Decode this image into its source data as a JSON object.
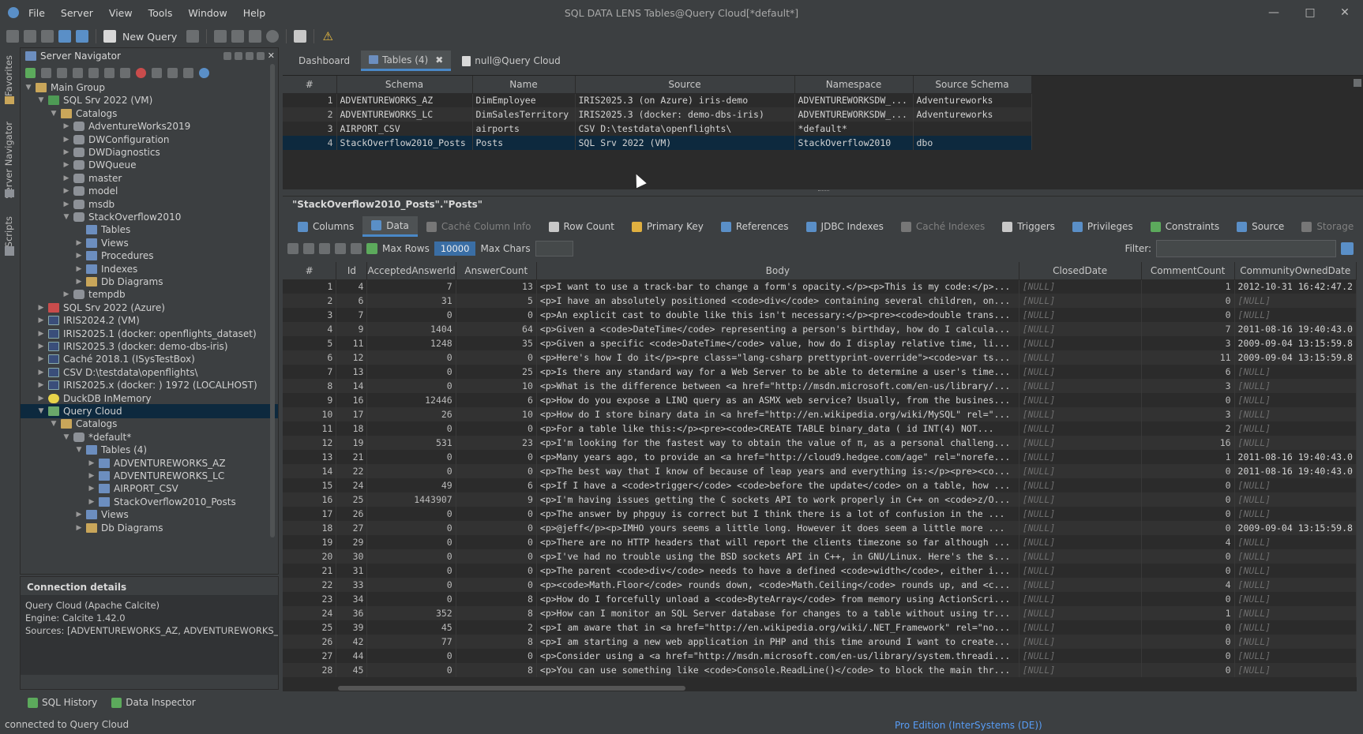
{
  "window": {
    "title": "SQL DATA LENS  Tables@Query Cloud[*default*]",
    "menu": [
      "File",
      "Server",
      "View",
      "Tools",
      "Window",
      "Help"
    ]
  },
  "toolbar": {
    "new_query_label": "New Query"
  },
  "side_tabs": [
    "Favorites",
    "Server Navigator",
    "Scripts"
  ],
  "navigator": {
    "title": "Server Navigator",
    "tree": [
      {
        "label": "Main Group",
        "depth": 0,
        "icon": "folder-icon",
        "expand": "v"
      },
      {
        "label": "SQL Srv 2022 (VM)",
        "depth": 1,
        "icon": "server-icon",
        "expand": "v"
      },
      {
        "label": "Catalogs",
        "depth": 2,
        "icon": "folder-icon",
        "expand": "v"
      },
      {
        "label": "AdventureWorks2019",
        "depth": 3,
        "icon": "database-icon",
        "expand": ">"
      },
      {
        "label": "DWConfiguration",
        "depth": 3,
        "icon": "database-icon",
        "expand": ">"
      },
      {
        "label": "DWDiagnostics",
        "depth": 3,
        "icon": "database-icon",
        "expand": ">"
      },
      {
        "label": "DWQueue",
        "depth": 3,
        "icon": "database-icon",
        "expand": ">"
      },
      {
        "label": "master",
        "depth": 3,
        "icon": "database-icon",
        "expand": ">"
      },
      {
        "label": "model",
        "depth": 3,
        "icon": "database-icon",
        "expand": ">"
      },
      {
        "label": "msdb",
        "depth": 3,
        "icon": "database-icon",
        "expand": ">"
      },
      {
        "label": "StackOverflow2010",
        "depth": 3,
        "icon": "database-icon",
        "expand": "v"
      },
      {
        "label": "Tables",
        "depth": 4,
        "icon": "table-icon",
        "expand": ""
      },
      {
        "label": "Views",
        "depth": 4,
        "icon": "table-icon",
        "expand": ">"
      },
      {
        "label": "Procedures",
        "depth": 4,
        "icon": "table-icon",
        "expand": ">"
      },
      {
        "label": "Indexes",
        "depth": 4,
        "icon": "table-icon",
        "expand": ">"
      },
      {
        "label": "Db Diagrams",
        "depth": 4,
        "icon": "folder-icon",
        "expand": ">"
      },
      {
        "label": "tempdb",
        "depth": 3,
        "icon": "database-icon",
        "expand": ">"
      },
      {
        "label": "SQL Srv 2022 (Azure)",
        "depth": 1,
        "icon": "server-red-icon",
        "expand": ">"
      },
      {
        "label": "IRIS2024.2 (VM)",
        "depth": 1,
        "icon": "iris-icon",
        "expand": ">"
      },
      {
        "label": "IRIS2025.1 (docker: openflights_dataset)",
        "depth": 1,
        "icon": "iris-icon",
        "expand": ">"
      },
      {
        "label": "IRIS2025.3 (docker: demo-dbs-iris)",
        "depth": 1,
        "icon": "iris-icon",
        "expand": ">"
      },
      {
        "label": "Caché 2018.1 (ISysTestBox)",
        "depth": 1,
        "icon": "iris-icon",
        "expand": ">"
      },
      {
        "label": "CSV D:\\testdata\\openflights\\",
        "depth": 1,
        "icon": "iris-icon",
        "expand": ">"
      },
      {
        "label": "IRIS2025.x (docker: ) 1972 (LOCALHOST)",
        "depth": 1,
        "icon": "iris-icon",
        "expand": ">"
      },
      {
        "label": "DuckDB InMemory",
        "depth": 1,
        "icon": "duckdb-icon",
        "expand": ">"
      },
      {
        "label": "Query Cloud",
        "depth": 1,
        "icon": "query-cloud-icon",
        "expand": "v",
        "selected": true
      },
      {
        "label": "Catalogs",
        "depth": 2,
        "icon": "folder-icon",
        "expand": "v"
      },
      {
        "label": "*default*",
        "depth": 3,
        "icon": "database-icon",
        "expand": "v"
      },
      {
        "label": "Tables (4)",
        "depth": 4,
        "icon": "table-icon",
        "expand": "v"
      },
      {
        "label": "ADVENTUREWORKS_AZ",
        "depth": 5,
        "icon": "table-icon",
        "expand": ">"
      },
      {
        "label": "ADVENTUREWORKS_LC",
        "depth": 5,
        "icon": "table-icon",
        "expand": ">"
      },
      {
        "label": "AIRPORT_CSV",
        "depth": 5,
        "icon": "table-icon",
        "expand": ">"
      },
      {
        "label": "StackOverflow2010_Posts",
        "depth": 5,
        "icon": "table-icon",
        "expand": ">"
      },
      {
        "label": "Views",
        "depth": 4,
        "icon": "table-icon",
        "expand": ">"
      },
      {
        "label": "Db Diagrams",
        "depth": 4,
        "icon": "folder-icon",
        "expand": ">"
      }
    ]
  },
  "connection_details": {
    "title": "Connection details",
    "lines": [
      "Query Cloud (Apache Calcite)",
      "Engine: Calcite 1.42.0",
      "Sources: [ADVENTUREWORKS_AZ, ADVENTUREWORKS_LC, A"
    ]
  },
  "bottom_tabs": [
    "SQL History",
    "Data Inspector"
  ],
  "status": {
    "text": "connected to Query Cloud",
    "edition": "Pro Edition (InterSystems (DE))"
  },
  "editor_tabs": [
    "Dashboard",
    "Tables (4)",
    "null@Query Cloud"
  ],
  "tables_grid": {
    "columns": [
      "#",
      "Schema",
      "Name",
      "Source",
      "Namespace",
      "Source Schema"
    ],
    "rows": [
      [
        "1",
        "ADVENTUREWORKS_AZ",
        "DimEmployee",
        "IRIS2025.3 (on Azure) iris-demo",
        "ADVENTUREWORKSDW_...",
        "Adventureworks"
      ],
      [
        "2",
        "ADVENTUREWORKS_LC",
        "DimSalesTerritory",
        "IRIS2025.3 (docker: demo-dbs-iris)",
        "ADVENTUREWORKSDW_...",
        "Adventureworks"
      ],
      [
        "3",
        "AIRPORT_CSV",
        "airports",
        "CSV D:\\testdata\\openflights\\",
        "*default*",
        ""
      ],
      [
        "4",
        "StackOverflow2010_Posts",
        "Posts",
        "SQL Srv 2022 (VM)",
        "StackOverflow2010",
        "dbo"
      ]
    ]
  },
  "object_title": "\"StackOverflow2010_Posts\".\"Posts\"",
  "sub_tabs": [
    {
      "label": "Columns",
      "disabled": false
    },
    {
      "label": "Data",
      "disabled": false,
      "active": true
    },
    {
      "label": "Caché Column Info",
      "disabled": true
    },
    {
      "label": "Row Count",
      "disabled": false
    },
    {
      "label": "Primary Key",
      "disabled": false
    },
    {
      "label": "References",
      "disabled": false
    },
    {
      "label": "JDBC Indexes",
      "disabled": false
    },
    {
      "label": "Caché Indexes",
      "disabled": true
    },
    {
      "label": "Triggers",
      "disabled": false
    },
    {
      "label": "Privileges",
      "disabled": false
    },
    {
      "label": "Constraints",
      "disabled": false
    },
    {
      "label": "Source",
      "disabled": false
    },
    {
      "label": "Storage",
      "disabled": true
    }
  ],
  "data_toolbar": {
    "max_rows_label": "Max Rows",
    "max_rows_value": "10000",
    "max_chars_label": "Max Chars",
    "max_chars_value": "",
    "filter_label": "Filter:"
  },
  "data_grid": {
    "columns": [
      "#",
      "Id",
      "AcceptedAnswerId",
      "AnswerCount",
      "Body",
      "ClosedDate",
      "CommentCount",
      "CommunityOwnedDate"
    ],
    "null_text": "[NULL]",
    "rows": [
      [
        "1",
        "4",
        "7",
        "13",
        "<p>I want to use a track-bar to change a form's opacity.</p><p>This is my code:</p>...",
        null,
        "1",
        "2012-10-31 16:42:47.2"
      ],
      [
        "2",
        "6",
        "31",
        "5",
        "<p>I have an absolutely positioned <code>div</code> containing several children, on...",
        null,
        "0",
        null
      ],
      [
        "3",
        "7",
        "0",
        "0",
        "<p>An explicit cast to double like this isn't necessary:</p><pre><code>double trans...",
        null,
        "0",
        null
      ],
      [
        "4",
        "9",
        "1404",
        "64",
        "<p>Given a <code>DateTime</code> representing a person's birthday, how do I calcula...",
        null,
        "7",
        "2011-08-16 19:40:43.0"
      ],
      [
        "5",
        "11",
        "1248",
        "35",
        "<p>Given a specific <code>DateTime</code> value, how do I display relative time, li...",
        null,
        "3",
        "2009-09-04 13:15:59.8"
      ],
      [
        "6",
        "12",
        "0",
        "0",
        "<p>Here's how I do it</p><pre class=\"lang-csharp prettyprint-override\"><code>var ts...",
        null,
        "11",
        "2009-09-04 13:15:59.8"
      ],
      [
        "7",
        "13",
        "0",
        "25",
        "<p>Is there any standard way for a Web Server to be able to determine a user's time...",
        null,
        "6",
        null
      ],
      [
        "8",
        "14",
        "0",
        "10",
        "<p>What is the difference between <a href=\"http://msdn.microsoft.com/en-us/library/...",
        null,
        "3",
        null
      ],
      [
        "9",
        "16",
        "12446",
        "6",
        "<p>How do you expose a LINQ query as an ASMX web service? Usually, from the busines...",
        null,
        "0",
        null
      ],
      [
        "10",
        "17",
        "26",
        "10",
        "<p>How do I store binary data in <a href=\"http://en.wikipedia.org/wiki/MySQL\" rel=\"...",
        null,
        "3",
        null
      ],
      [
        "11",
        "18",
        "0",
        "0",
        "<p>For a table like this:</p><pre><code>CREATE TABLE binary_data (    id INT(4) NOT...",
        null,
        "2",
        null
      ],
      [
        "12",
        "19",
        "531",
        "23",
        "<p>I'm looking for the fastest way to obtain the value of π, as a personal challeng...",
        null,
        "16",
        null
      ],
      [
        "13",
        "21",
        "0",
        "0",
        "<p>Many years ago, to provide an <a href=\"http://cloud9.hedgee.com/age\" rel=\"norefe...",
        null,
        "1",
        "2011-08-16 19:40:43.0"
      ],
      [
        "14",
        "22",
        "0",
        "0",
        "<p>The best way that I know of because of leap years and everything is:</p><pre><co...",
        null,
        "0",
        "2011-08-16 19:40:43.0"
      ],
      [
        "15",
        "24",
        "49",
        "6",
        "<p>If I have a <code>trigger</code> <code>before the update</code> on a table, how ...",
        null,
        "0",
        null
      ],
      [
        "16",
        "25",
        "1443907",
        "9",
        "<p>I'm having issues getting the C sockets API to work properly in C++ on <code>z/O...",
        null,
        "0",
        null
      ],
      [
        "17",
        "26",
        "0",
        "0",
        "<p>The answer by phpguy is correct but I think there is a lot of confusion in the  ...",
        null,
        "0",
        null
      ],
      [
        "18",
        "27",
        "0",
        "0",
        "<p>@jeff</p><p>IMHO yours seems a little long.  However it does seem a little more ...",
        null,
        "0",
        "2009-09-04 13:15:59.8"
      ],
      [
        "19",
        "29",
        "0",
        "0",
        "<p>There are no HTTP headers that will report the clients timezone so far although ...",
        null,
        "4",
        null
      ],
      [
        "20",
        "30",
        "0",
        "0",
        "<p>I've had no trouble using the BSD sockets API in C++, in GNU/Linux. Here's the s...",
        null,
        "0",
        null
      ],
      [
        "21",
        "31",
        "0",
        "0",
        "<p>The parent <code>div</code> needs to have a defined <code>width</code>, either i...",
        null,
        "0",
        null
      ],
      [
        "22",
        "33",
        "0",
        "0",
        "<p><code>Math.Floor</code> rounds down, <code>Math.Ceiling</code> rounds up, and <c...",
        null,
        "4",
        null
      ],
      [
        "23",
        "34",
        "0",
        "8",
        "<p>How do I forcefully unload a <code>ByteArray</code> from memory using ActionScri...",
        null,
        "0",
        null
      ],
      [
        "24",
        "36",
        "352",
        "8",
        "<p>How can I monitor an SQL Server database for changes to a table without using tr...",
        null,
        "1",
        null
      ],
      [
        "25",
        "39",
        "45",
        "2",
        "<p>I am aware that in <a href=\"http://en.wikipedia.org/wiki/.NET_Framework\" rel=\"no...",
        null,
        "0",
        null
      ],
      [
        "26",
        "42",
        "77",
        "8",
        "<p>I am starting a new web application in PHP and this time around I want to create...",
        null,
        "0",
        null
      ],
      [
        "27",
        "44",
        "0",
        "0",
        "<p>Consider using a <a href=\"http://msdn.microsoft.com/en-us/library/system.threadi...",
        null,
        "0",
        null
      ],
      [
        "28",
        "45",
        "0",
        "8",
        "<p>You can use something like <code>Console.ReadLine()</code> to block the main thr...",
        null,
        "0",
        null
      ]
    ]
  }
}
